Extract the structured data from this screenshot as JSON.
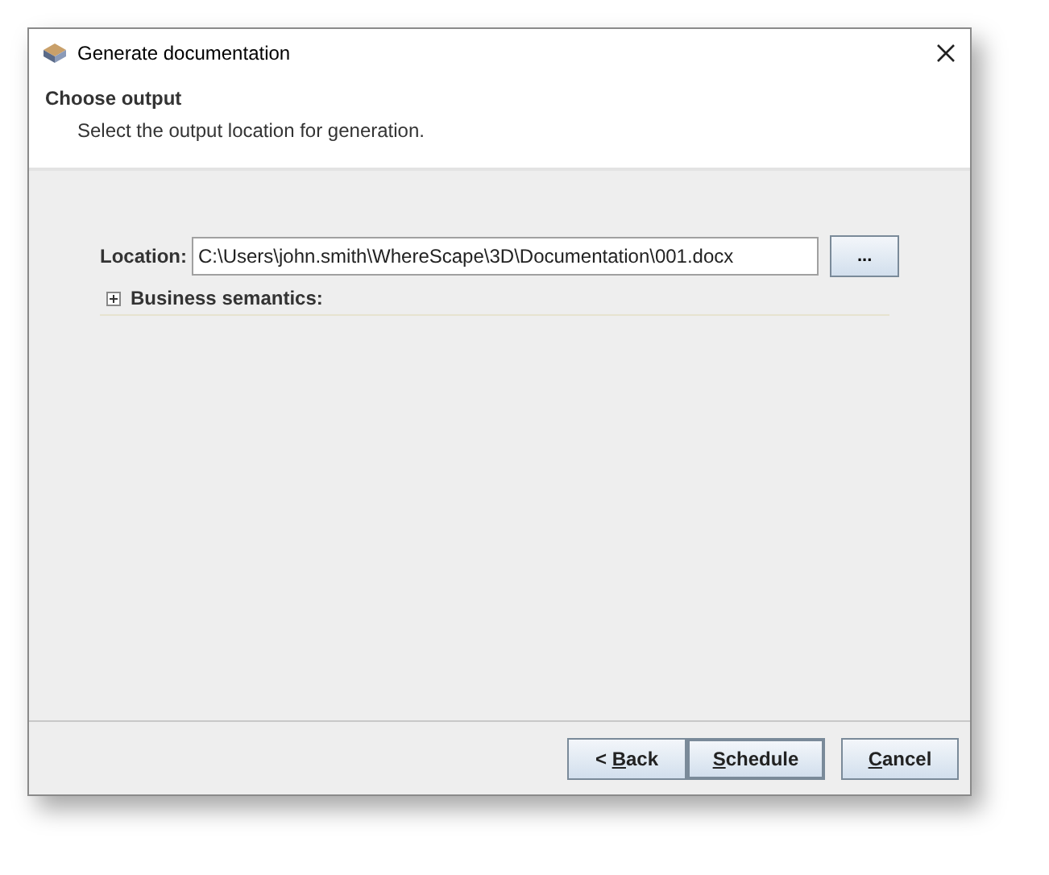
{
  "window": {
    "title": "Generate documentation"
  },
  "header": {
    "title": "Choose output",
    "subtitle": "Select the output location for generation."
  },
  "location": {
    "label": "Location:",
    "value": "C:\\Users\\john.smith\\WhereScape\\3D\\Documentation\\001.docx",
    "browse": "..."
  },
  "business_semantics": {
    "label": "Business semantics:",
    "expanded": false
  },
  "buttons": [
    {
      "prefix": "< ",
      "mnemonic": "B",
      "rest": "ack",
      "default": false
    },
    {
      "mnemonic": "S",
      "rest": "chedule",
      "default": true
    },
    {
      "mnemonic": "C",
      "rest": "ancel",
      "default": false
    }
  ]
}
